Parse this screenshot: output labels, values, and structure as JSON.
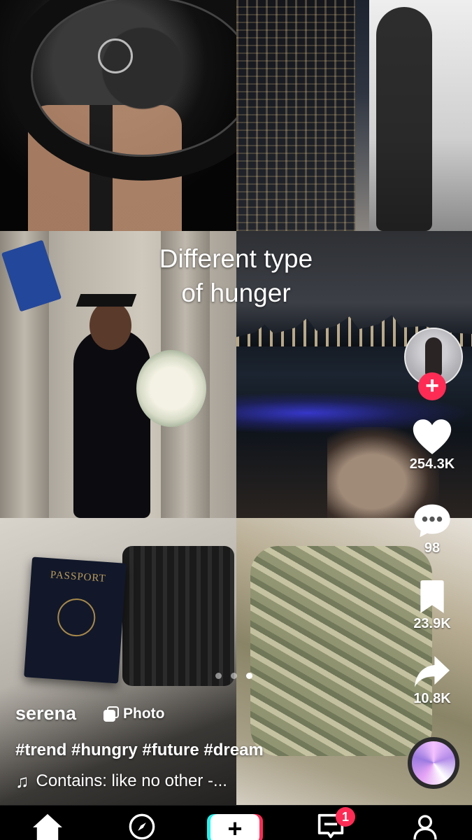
{
  "post": {
    "overlay_caption_line1": "Different type",
    "overlay_caption_line2": "of hunger",
    "username": "serena",
    "media_type_label": "Photo",
    "hashtags": "#trend #hungry #future #dream",
    "music_label": "Contains: like no other -...",
    "passport_text": "PASSPORT"
  },
  "slides": {
    "count": 3,
    "active_index": 2
  },
  "actions": {
    "follow_symbol": "+",
    "likes": "254.3K",
    "comments": "98",
    "saves": "23.9K",
    "shares": "10.8K"
  },
  "icons": {
    "like": "heart-icon",
    "comment": "comment-bubble-icon",
    "save": "bookmark-icon",
    "share": "share-arrow-icon",
    "music": "music-note-icon",
    "photo": "photo-stack-icon"
  },
  "nav": {
    "items": [
      "home",
      "discover",
      "create",
      "inbox",
      "profile"
    ],
    "inbox_badge": "1",
    "create_symbol": "+"
  },
  "colors": {
    "accent_red": "#fe2c55",
    "accent_cyan": "#25f4ee",
    "text": "#ffffff",
    "background": "#000000"
  }
}
